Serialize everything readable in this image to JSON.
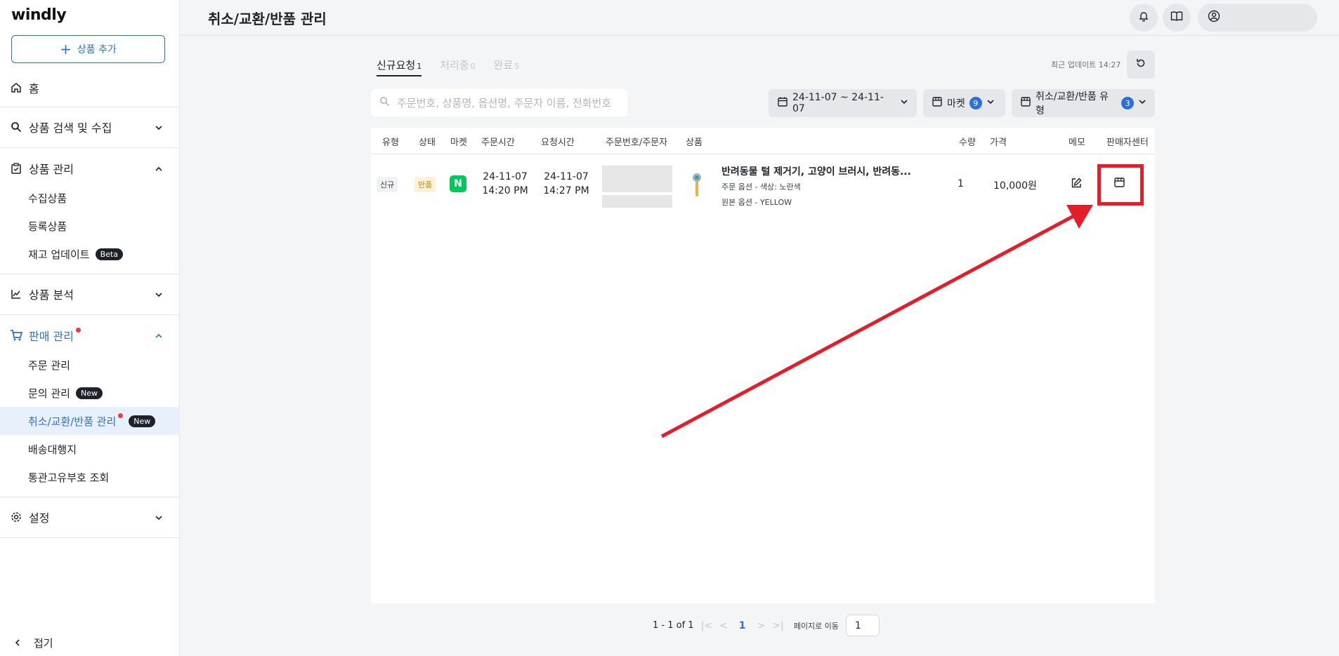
{
  "app": {
    "logo": "windly"
  },
  "sidebar": {
    "add_button": "상품 추가",
    "home": "홈",
    "sections": [
      {
        "label": "상품 검색 및 수집",
        "icon": "search-icon",
        "expanded": false
      },
      {
        "label": "상품 관리",
        "icon": "clipboard-check-icon",
        "expanded": true,
        "items": [
          {
            "label": "수집상품"
          },
          {
            "label": "등록상품"
          },
          {
            "label": "재고 업데이트",
            "badge": "Beta"
          }
        ]
      },
      {
        "label": "상품 분석",
        "icon": "chart-icon",
        "expanded": false
      },
      {
        "label": "판매 관리",
        "icon": "cart-icon",
        "expanded": true,
        "has_dot": true,
        "items": [
          {
            "label": "주문 관리"
          },
          {
            "label": "문의 관리",
            "badge": "New"
          },
          {
            "label": "취소/교환/반품 관리",
            "badge": "New",
            "selected": true,
            "has_dot": true
          },
          {
            "label": "배송대행지"
          },
          {
            "label": "통관고유부호 조회"
          }
        ]
      },
      {
        "label": "설정",
        "icon": "gear-icon",
        "expanded": false
      }
    ],
    "collapse_label": "접기"
  },
  "header": {
    "title": "취소/교환/반품 관리"
  },
  "tabs": [
    {
      "label": "신규요청",
      "count": "1",
      "active": true
    },
    {
      "label": "처리중",
      "count": "0",
      "active": false
    },
    {
      "label": "완료",
      "count": "5",
      "active": false
    }
  ],
  "last_update": "최근 업데이트 14:27",
  "search": {
    "placeholder": "주문번호, 상품명, 옵션명, 주문자 이름, 전화번호 검색",
    "value": ""
  },
  "filters": {
    "date_range": "24-11-07 ~ 24-11-07",
    "market_label": "마켓",
    "market_count": "9",
    "type_label": "취소/교환/반품 유형",
    "type_count": "3"
  },
  "table": {
    "columns": [
      "유형",
      "상태",
      "마켓",
      "주문시간",
      "요청시간",
      "주문번호/주문자",
      "상품",
      "수량",
      "가격",
      "메모",
      "판매자센터"
    ],
    "rows": [
      {
        "type": "신규",
        "status": "반품",
        "market_logo": "N",
        "order_date": "24-11-07",
        "order_time": "14:20 PM",
        "request_date": "24-11-07",
        "request_time": "14:27 PM",
        "product_name": "반려동물 털 제거기, 고양이 브러시, 반려동...",
        "order_option": "주문 옵션 - 색상: 노란색",
        "original_option": "원본 옵션 - YELLOW",
        "quantity": "1",
        "price": "10,000원"
      }
    ]
  },
  "pagination": {
    "range": "1 - 1 of 1",
    "current_page": "1",
    "goto_label": "페이지로 이동",
    "goto_value": "1"
  },
  "colors": {
    "accent": "#2d6fd9",
    "highlight": "#e31d2a",
    "naver_green": "#03c75a"
  }
}
